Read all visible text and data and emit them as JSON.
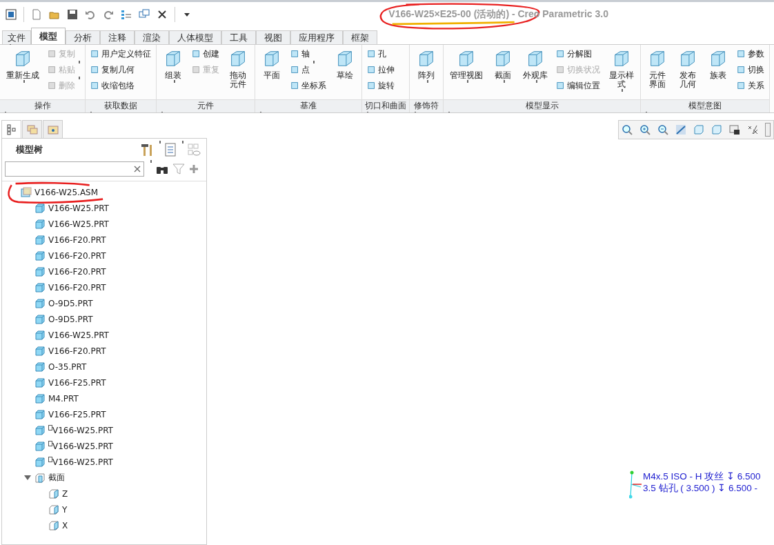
{
  "window": {
    "title": "V166-W25×E25-00 (活动的) - Creo Parametric 3.0"
  },
  "tabs": [
    {
      "label": "文件",
      "kind": "menu",
      "selected": false
    },
    {
      "label": "模型",
      "kind": "tab",
      "selected": true
    },
    {
      "label": "分析",
      "kind": "tab",
      "selected": false
    },
    {
      "label": "注释",
      "kind": "tab",
      "selected": false
    },
    {
      "label": "渲染",
      "kind": "tab",
      "selected": false
    },
    {
      "label": "人体模型",
      "kind": "tab",
      "selected": false
    },
    {
      "label": "工具",
      "kind": "tab",
      "selected": false
    },
    {
      "label": "视图",
      "kind": "tab",
      "selected": false
    },
    {
      "label": "应用程序",
      "kind": "tab",
      "selected": false
    },
    {
      "label": "框架",
      "kind": "tab",
      "selected": false
    }
  ],
  "ribbon": {
    "groups": [
      {
        "label": "操作",
        "columns": [
          {
            "kind": "large",
            "label": "重新生成",
            "dropdown": true,
            "disabled": false
          },
          {
            "kind": "stack",
            "rows": [
              {
                "label": "复制",
                "dropdown": false,
                "disabled": true
              },
              {
                "label": "粘贴",
                "dropdown": true,
                "disabled": true
              },
              {
                "label": "删除",
                "dropdown": true,
                "disabled": true
              }
            ]
          }
        ]
      },
      {
        "label": "获取数据",
        "columns": [
          {
            "kind": "stack",
            "rows": [
              {
                "label": "用户定义特征",
                "dropdown": false,
                "disabled": false
              },
              {
                "label": "复制几何",
                "dropdown": false,
                "disabled": false
              },
              {
                "label": "收缩包络",
                "dropdown": false,
                "disabled": false
              }
            ]
          }
        ]
      },
      {
        "label": "元件",
        "columns": [
          {
            "kind": "large",
            "label": "组装",
            "dropdown": true,
            "disabled": false
          },
          {
            "kind": "stack",
            "rows": [
              {
                "label": "创建",
                "dropdown": false,
                "disabled": false
              },
              {
                "label": "重复",
                "dropdown": false,
                "disabled": true
              }
            ]
          },
          {
            "kind": "large",
            "label": "拖动元件",
            "dropdown": false,
            "disabled": false
          }
        ]
      },
      {
        "label": "基准",
        "columns": [
          {
            "kind": "large",
            "label": "平面",
            "dropdown": false,
            "disabled": false
          },
          {
            "kind": "stack",
            "rows": [
              {
                "label": "轴",
                "dropdown": false,
                "disabled": false
              },
              {
                "label": "点",
                "dropdown": true,
                "disabled": false
              },
              {
                "label": "坐标系",
                "dropdown": false,
                "disabled": false
              }
            ]
          },
          {
            "kind": "large",
            "label": "草绘",
            "dropdown": false,
            "disabled": false
          }
        ]
      },
      {
        "label": "切口和曲面",
        "columns": [
          {
            "kind": "stack",
            "rows": [
              {
                "label": "孔",
                "dropdown": false,
                "disabled": false
              },
              {
                "label": "拉伸",
                "dropdown": false,
                "disabled": false
              },
              {
                "label": "旋转",
                "dropdown": false,
                "disabled": false
              }
            ]
          }
        ]
      },
      {
        "label": "修饰符",
        "columns": [
          {
            "kind": "large",
            "label": "阵列",
            "dropdown": true,
            "disabled": false
          }
        ]
      },
      {
        "label": "模型显示",
        "columns": [
          {
            "kind": "large",
            "label": "管理视图",
            "dropdown": true,
            "disabled": false
          },
          {
            "kind": "large",
            "label": "截面",
            "dropdown": true,
            "disabled": false
          },
          {
            "kind": "large",
            "label": "外观库",
            "dropdown": true,
            "disabled": false
          },
          {
            "kind": "stack",
            "rows": [
              {
                "label": "分解图",
                "dropdown": false,
                "disabled": false
              },
              {
                "label": "切换状况",
                "dropdown": false,
                "disabled": true
              },
              {
                "label": "编辑位置",
                "dropdown": false,
                "disabled": false
              }
            ]
          },
          {
            "kind": "large",
            "label": "显示样式",
            "dropdown": true,
            "disabled": false
          }
        ]
      },
      {
        "label": "模型意图",
        "columns": [
          {
            "kind": "large",
            "label": "元件界面",
            "dropdown": false,
            "disabled": false
          },
          {
            "kind": "large",
            "label": "发布几何",
            "dropdown": false,
            "disabled": false
          },
          {
            "kind": "large",
            "label": "族表",
            "dropdown": false,
            "disabled": false
          },
          {
            "kind": "stack",
            "rows": [
              {
                "label": "参数",
                "dropdown": false,
                "disabled": false
              },
              {
                "label": "切换",
                "dropdown": false,
                "disabled": false
              },
              {
                "label": "关系",
                "dropdown": false,
                "disabled": false
              }
            ]
          }
        ]
      }
    ]
  },
  "navigator": {
    "tabs": [
      {
        "selected": true
      },
      {
        "selected": false
      },
      {
        "selected": false
      }
    ],
    "title": "模型树",
    "tree": {
      "label": "V166-W25.ASM",
      "kind": "assembly",
      "marked": false,
      "children": [
        {
          "label": "V166-W25.PRT",
          "kind": "part",
          "marked": false
        },
        {
          "label": "V166-W25.PRT",
          "kind": "part",
          "marked": false
        },
        {
          "label": "V166-F20.PRT",
          "kind": "part",
          "marked": false
        },
        {
          "label": "V166-F20.PRT",
          "kind": "part",
          "marked": false
        },
        {
          "label": "V166-F20.PRT",
          "kind": "part",
          "marked": false
        },
        {
          "label": "V166-F20.PRT",
          "kind": "part",
          "marked": false
        },
        {
          "label": "O-9D5.PRT",
          "kind": "part",
          "marked": false
        },
        {
          "label": "O-9D5.PRT",
          "kind": "part",
          "marked": false
        },
        {
          "label": "V166-W25.PRT",
          "kind": "part",
          "marked": false
        },
        {
          "label": "V166-F20.PRT",
          "kind": "part",
          "marked": false
        },
        {
          "label": "O-35.PRT",
          "kind": "part",
          "marked": false
        },
        {
          "label": "V166-F25.PRT",
          "kind": "part",
          "marked": false
        },
        {
          "label": "M4.PRT",
          "kind": "part",
          "marked": false
        },
        {
          "label": "V166-F25.PRT",
          "kind": "part",
          "marked": false
        },
        {
          "label": "V166-W25.PRT",
          "kind": "part",
          "marked": true
        },
        {
          "label": "V166-W25.PRT",
          "kind": "part",
          "marked": true
        },
        {
          "label": "V166-W25.PRT",
          "kind": "part",
          "marked": true
        },
        {
          "label": "截面",
          "kind": "sections",
          "marked": false,
          "expanded": true,
          "children": [
            {
              "label": "Z",
              "kind": "section",
              "marked": false
            },
            {
              "label": "Y",
              "kind": "section",
              "marked": false
            },
            {
              "label": "X",
              "kind": "section",
              "marked": false
            }
          ]
        }
      ]
    }
  },
  "graphics": {
    "annotations": [
      "M4x.5 ISO - H 攻丝 ↧ 6.500",
      "3.5 钻孔 ( 3.500 ) ↧ 6.500 -"
    ]
  }
}
